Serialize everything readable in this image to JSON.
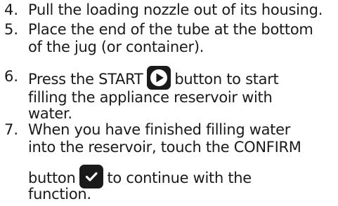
{
  "steps": [
    {
      "number": "4.",
      "lines": [
        "Pull the loading nozzle out of its housing."
      ]
    },
    {
      "number": "5.",
      "lines": [
        "Place the end of the tube at the bottom",
        "of the jug (or container)."
      ]
    },
    {
      "number": "6.",
      "before_icon": "Press the START",
      "icon": "play-icon",
      "after_icon": "button to start",
      "lines": [
        "filling the appliance reservoir with",
        "water."
      ]
    },
    {
      "number": "7.",
      "lines": [
        "When you have finished filling water",
        "into the reservoir, touch the CONFIRM"
      ],
      "before_icon": "button",
      "icon": "check-icon",
      "after_icon": "to continue with the",
      "tail": "function."
    }
  ],
  "colors": {
    "text": "#1a1a1a",
    "icon_bg": "#1a1a1a",
    "icon_fg": "#ffffff"
  }
}
